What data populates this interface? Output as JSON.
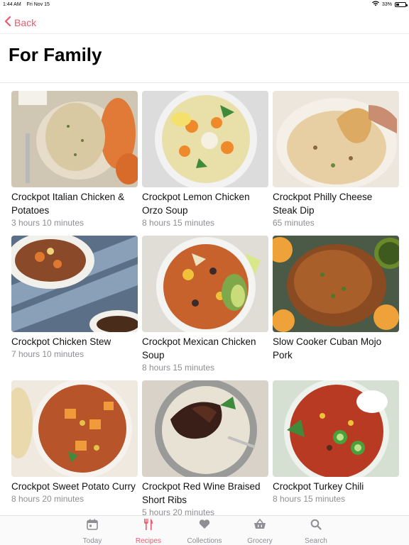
{
  "status_bar": {
    "time": "1:44 AM",
    "date": "Fri Nov 15",
    "battery": "33%"
  },
  "nav": {
    "back_label": "Back"
  },
  "page_title": "For Family",
  "recipes": [
    {
      "title": "Crockpot Italian Chicken & Potatoes",
      "time": "3 hours 10 minutes"
    },
    {
      "title": "Crockpot Lemon Chicken Orzo Soup",
      "time": "8 hours 15 minutes"
    },
    {
      "title": "Crockpot Philly Cheese Steak Dip",
      "time": "65 minutes"
    },
    {
      "title": "Crockpot Chicken Stew",
      "time": "7 hours 10 minutes"
    },
    {
      "title": "Crockpot Mexican Chicken Soup",
      "time": "8 hours 15 minutes"
    },
    {
      "title": "Slow Cooker Cuban Mojo Pork",
      "time": ""
    },
    {
      "title": "Crockpot Sweet Potato Curry",
      "time": "8 hours 20 minutes"
    },
    {
      "title": "Crockpot Red Wine Braised Short Ribs",
      "time": "5 hours 20 minutes"
    },
    {
      "title": "Crockpot Turkey Chili",
      "time": "8 hours 15 minutes"
    }
  ],
  "tabs": [
    {
      "label": "Today",
      "icon": "calendar-icon"
    },
    {
      "label": "Recipes",
      "icon": "utensils-icon"
    },
    {
      "label": "Collections",
      "icon": "heart-icon"
    },
    {
      "label": "Grocery",
      "icon": "basket-icon"
    },
    {
      "label": "Search",
      "icon": "search-icon"
    }
  ],
  "active_tab": "Recipes",
  "colors": {
    "accent": "#ee5a6e",
    "inactive": "#8e8e93"
  }
}
